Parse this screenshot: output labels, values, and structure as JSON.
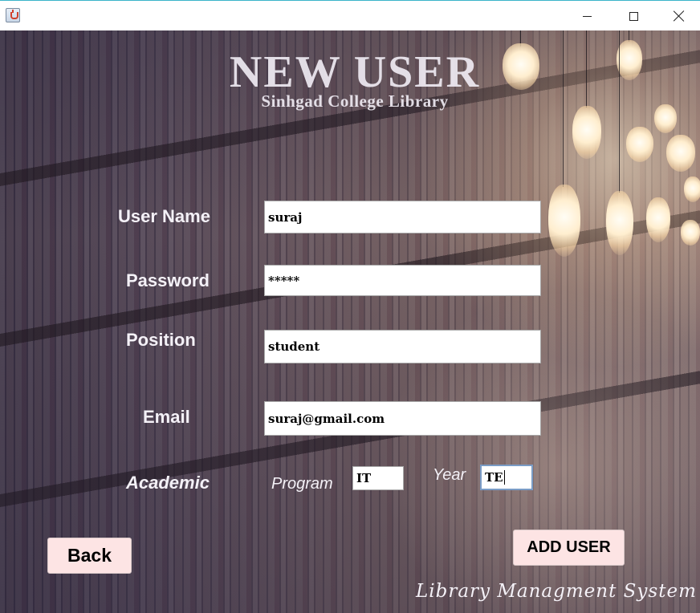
{
  "window": {
    "icon": "java-cup-icon",
    "controls": {
      "minimize": "minimize-icon",
      "maximize": "maximize-icon",
      "close": "close-icon"
    }
  },
  "header": {
    "title": "NEW USER",
    "subtitle": "Sinhgad College Library"
  },
  "form": {
    "username": {
      "label": "User Name",
      "value": "suraj"
    },
    "password": {
      "label": "Password",
      "value": "*****"
    },
    "position": {
      "label": "Position",
      "value": "student"
    },
    "email": {
      "label": "Email",
      "value": "suraj@gmail.com"
    },
    "academic": {
      "label": "Academic",
      "program_label": "Program",
      "program_value": "IT",
      "year_label": "Year",
      "year_value": "TE"
    }
  },
  "buttons": {
    "back": "Back",
    "add_user": "ADD USER"
  },
  "footer": {
    "text": "Library Managment System"
  },
  "colors": {
    "button_bg": "#fde4e4",
    "label_text": "#f4f1f7",
    "focus_border": "#7a9cc6",
    "titlebar_accent": "#3bb4c9"
  }
}
